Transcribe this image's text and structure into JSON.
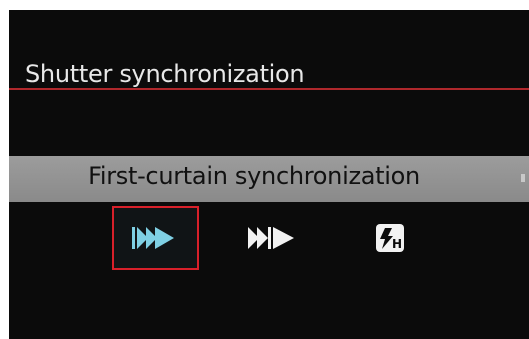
{
  "screen": {
    "title": "Shutter synchronization",
    "selected_label": "First-curtain synchronization",
    "options": [
      {
        "name": "first-curtain-sync",
        "icon": "first-curtain-sync-icon",
        "selected": true
      },
      {
        "name": "second-curtain-sync",
        "icon": "second-curtain-sync-icon",
        "selected": false
      },
      {
        "name": "high-speed-sync",
        "icon": "high-speed-sync-icon",
        "label": "H",
        "selected": false
      }
    ]
  },
  "colors": {
    "accent_red": "#d8202a",
    "selected_icon": "#7fd0e4",
    "icon": "#f2f2f2"
  }
}
